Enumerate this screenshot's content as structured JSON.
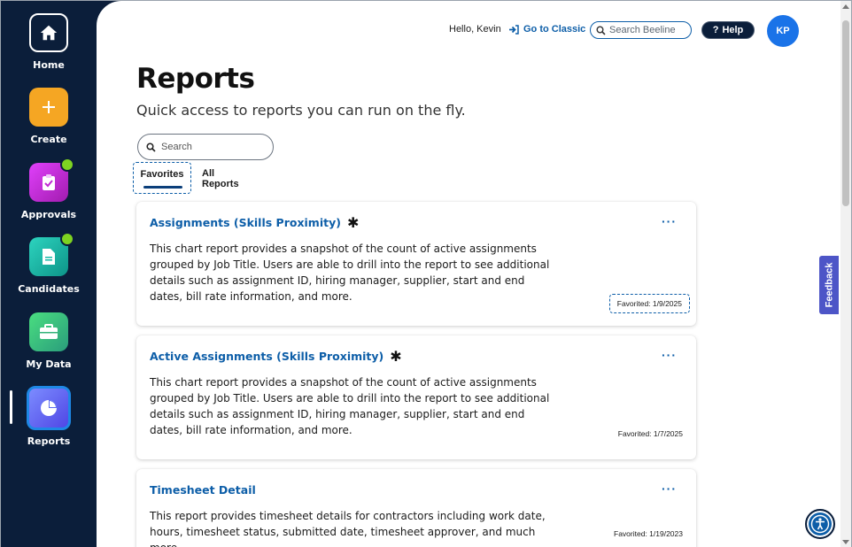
{
  "colors": {
    "sidebar_bg": "#0b1e3a",
    "link_blue": "#0d5ea8",
    "home_tile": "#0b1e3a",
    "create_tile": "#f5a623",
    "approvals_tile": "#c026d3",
    "candidates_tile": "#14b8a6",
    "mydata_tile": "#34b37a",
    "reports_tile": "#5b6af0",
    "badge": "#7ed321",
    "feedback": "#4d55c7"
  },
  "sidebar": {
    "items": [
      {
        "label": "Home",
        "icon": "home-icon"
      },
      {
        "label": "Create",
        "icon": "plus-icon"
      },
      {
        "label": "Approvals",
        "icon": "clipboard-check-icon"
      },
      {
        "label": "Candidates",
        "icon": "document-icon"
      },
      {
        "label": "My Data",
        "icon": "briefcase-icon"
      },
      {
        "label": "Reports",
        "icon": "pie-chart-icon"
      }
    ]
  },
  "header": {
    "greeting": "Hello, Kevin",
    "classic_link": "Go to Classic",
    "search_placeholder": "Search Beeline",
    "help_label": "Help",
    "avatar_initials": "KP"
  },
  "page": {
    "title": "Reports",
    "subtitle": "Quick access to reports you can run on the fly.",
    "search_placeholder": "Search",
    "tabs": [
      {
        "label": "Favorites",
        "active": true
      },
      {
        "label": "All Reports",
        "active": false
      }
    ]
  },
  "reports": [
    {
      "title": "Assignments (Skills Proximity)",
      "starred": true,
      "description": "This chart report provides a snapshot of the count of active assignments grouped by Job Title. Users are able to drill into the report to see additional details such as assignment ID, hiring manager, supplier, start and end dates, bill rate information, and more.",
      "favorited": "Favorited: 1/9/2025",
      "menu": "···"
    },
    {
      "title": "Active Assignments (Skills Proximity)",
      "starred": true,
      "description": "This chart report provides a snapshot of the count of active assignments grouped by Job Title. Users are able to drill into the report to see additional details such as assignment ID, hiring manager, supplier, start and end dates, bill rate information, and more.",
      "favorited": "Favorited: 1/7/2025",
      "menu": "···"
    },
    {
      "title": "Timesheet Detail",
      "starred": false,
      "description": "This report provides timesheet details for contractors including work date, hours, timesheet status, submitted date, timesheet approver, and much more.",
      "favorited": "Favorited: 1/19/2023",
      "menu": "···"
    }
  ],
  "feedback_label": "Feedback",
  "asterisk": "✱"
}
